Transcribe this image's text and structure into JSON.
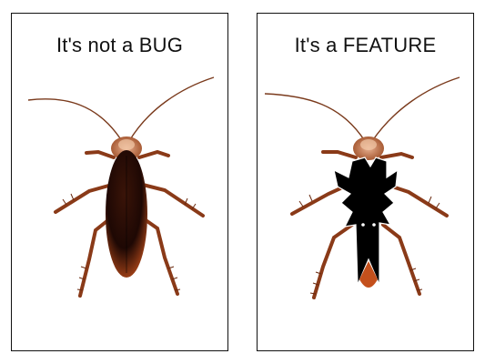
{
  "panels": [
    {
      "caption": "It's not a BUG",
      "image": "cockroach-bug"
    },
    {
      "caption": "It's a FEATURE",
      "image": "cockroach-batman"
    }
  ],
  "colors": {
    "border": "#111111",
    "bug_body": "#2a0f05",
    "bug_rim": "#a03c12",
    "legs": "#8a3a18",
    "costume": "#000000",
    "costume_cape_inner": "#c4501c"
  }
}
